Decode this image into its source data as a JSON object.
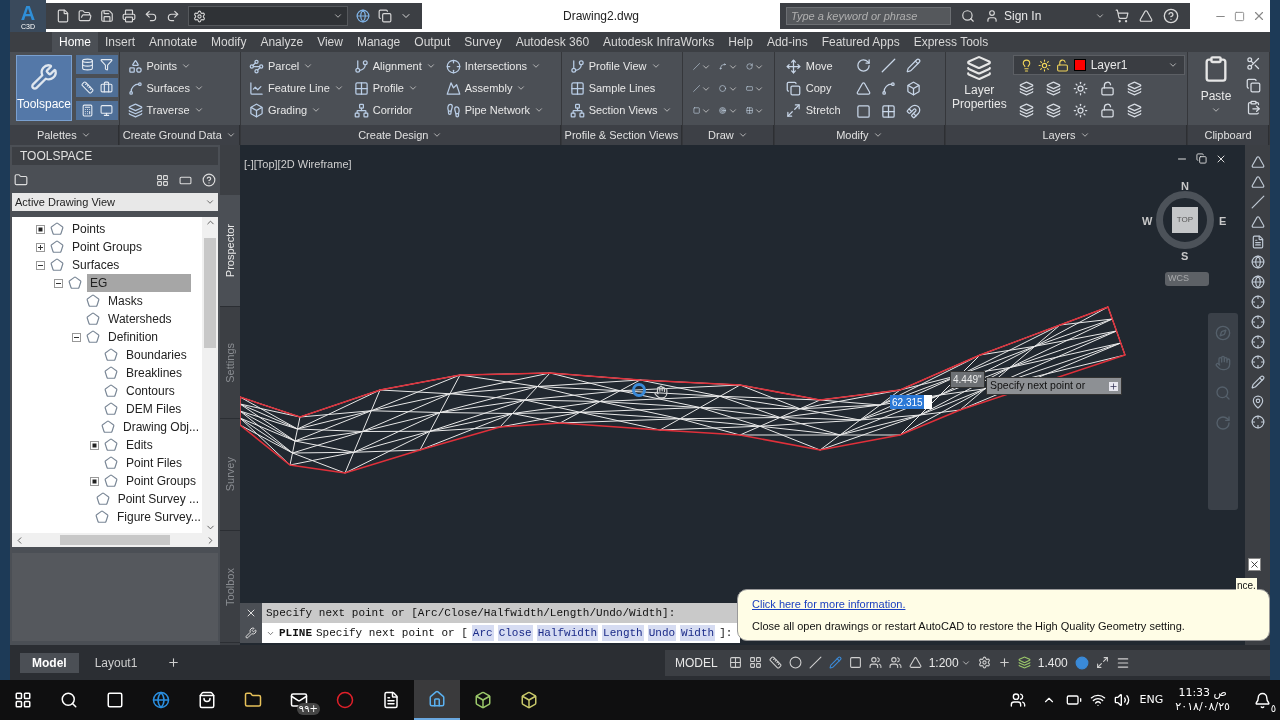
{
  "title_bar": {
    "logo_letter": "A",
    "logo_caption": "C3D",
    "document_title": "Drawing2.dwg",
    "search": {
      "placeholder": "Type a keyword or phrase"
    },
    "sign_in": "Sign In"
  },
  "ribbon_tabs": [
    {
      "label": "Home",
      "selected": true
    },
    {
      "label": "Insert",
      "selected": false
    },
    {
      "label": "Annotate",
      "selected": false
    },
    {
      "label": "Modify",
      "selected": false
    },
    {
      "label": "Analyze",
      "selected": false
    },
    {
      "label": "View",
      "selected": false
    },
    {
      "label": "Manage",
      "selected": false
    },
    {
      "label": "Output",
      "selected": false
    },
    {
      "label": "Survey",
      "selected": false
    },
    {
      "label": "Autodesk 360",
      "selected": false
    },
    {
      "label": "Autodesk InfraWorks",
      "selected": false
    },
    {
      "label": "Help",
      "selected": false
    },
    {
      "label": "Add-ins",
      "selected": false
    },
    {
      "label": "Featured Apps",
      "selected": false
    },
    {
      "label": "Express Tools",
      "selected": false
    }
  ],
  "ribbon_panels": [
    {
      "kind": "palettes",
      "title": "Palettes",
      "menu": true,
      "large": {
        "label": "Toolspace",
        "selected": true
      }
    },
    {
      "kind": "list",
      "title": "Create Ground Data",
      "menu": true,
      "columns": [
        [
          {
            "label": "Points",
            "dropdown": true
          },
          {
            "label": "Surfaces",
            "dropdown": true
          },
          {
            "label": "Traverse",
            "dropdown": true
          }
        ]
      ]
    },
    {
      "kind": "list",
      "title": "Create Design",
      "menu": true,
      "columns": [
        [
          {
            "label": "Parcel",
            "dropdown": true
          },
          {
            "label": "Feature Line",
            "dropdown": true
          },
          {
            "label": "Grading",
            "dropdown": true
          }
        ],
        [
          {
            "label": "Alignment",
            "dropdown": true
          },
          {
            "label": "Profile",
            "dropdown": true
          },
          {
            "label": "Corridor",
            "dropdown": false
          }
        ],
        [
          {
            "label": "Intersections",
            "dropdown": true
          },
          {
            "label": "Assembly",
            "dropdown": true
          },
          {
            "label": "Pipe Network",
            "dropdown": true
          }
        ]
      ]
    },
    {
      "kind": "list",
      "title": "Profile & Section Views",
      "menu": false,
      "columns": [
        [
          {
            "label": "Profile View",
            "dropdown": true
          },
          {
            "label": "Sample Lines",
            "dropdown": false
          },
          {
            "label": "Section Views",
            "dropdown": true
          }
        ]
      ]
    },
    {
      "kind": "draw",
      "title": "Draw",
      "menu": true
    },
    {
      "kind": "modify",
      "title": "Modify",
      "menu": true,
      "columns": [
        [
          {
            "label": "Move",
            "dropdown": false
          },
          {
            "label": "Copy",
            "dropdown": false
          },
          {
            "label": "Stretch",
            "dropdown": false
          }
        ]
      ]
    },
    {
      "kind": "layers",
      "title": "Layers",
      "menu": true,
      "large": {
        "label": "Layer Properties",
        "selected": false
      },
      "layer": {
        "name": "Layer1",
        "color": "#ff0000"
      }
    },
    {
      "kind": "clipboard",
      "title": "Clipboard",
      "menu": false,
      "large": {
        "label": "Paste",
        "selected": false
      }
    }
  ],
  "toolspace": {
    "title": "TOOLSPACE",
    "view": "Active Drawing View",
    "tree": [
      {
        "label": "Points",
        "kind": "dot",
        "selected": false
      },
      {
        "label": "Point Groups",
        "kind": "plus",
        "selected": false
      },
      {
        "label": "Surfaces",
        "kind": "minus",
        "selected": false,
        "children": [
          {
            "label": "EG",
            "kind": "minus",
            "selected": true,
            "children": [
              {
                "label": "Masks",
                "kind": "leaf",
                "selected": false
              },
              {
                "label": "Watersheds",
                "kind": "leaf",
                "selected": false
              },
              {
                "label": "Definition",
                "kind": "minus",
                "selected": false,
                "children": [
                  {
                    "label": "Boundaries",
                    "kind": "leaf",
                    "selected": false
                  },
                  {
                    "label": "Breaklines",
                    "kind": "leaf",
                    "selected": false
                  },
                  {
                    "label": "Contours",
                    "kind": "leaf",
                    "selected": false
                  },
                  {
                    "label": "DEM Files",
                    "kind": "leaf",
                    "selected": false
                  },
                  {
                    "label": "Drawing Obj...",
                    "kind": "leaf",
                    "selected": false
                  },
                  {
                    "label": "Edits",
                    "kind": "dot",
                    "selected": false
                  },
                  {
                    "label": "Point Files",
                    "kind": "leaf",
                    "selected": false
                  },
                  {
                    "label": "Point Groups",
                    "kind": "dot",
                    "selected": false
                  },
                  {
                    "label": "Point Survey ...",
                    "kind": "leaf",
                    "selected": false
                  },
                  {
                    "label": "Figure Survey...",
                    "kind": "leaf",
                    "selected": false
                  }
                ]
              }
            ]
          }
        ]
      }
    ],
    "side_tabs": [
      {
        "label": "Prospector",
        "selected": true
      },
      {
        "label": "Settings",
        "selected": false
      },
      {
        "label": "Survey",
        "selected": false
      },
      {
        "label": "Toolbox",
        "selected": false
      }
    ]
  },
  "viewport": {
    "label": "[-][Top][2D Wireframe]",
    "viewcube": {
      "face": "TOP",
      "north": "N",
      "south": "S",
      "east": "E",
      "west": "W",
      "ucs": "WCS"
    },
    "tooltip": {
      "dimension": "4.449\"",
      "input": "62.315",
      "prompt": "Specify next point or"
    }
  },
  "command_line": {
    "history": "Specify next point or [Arc/Close/Halfwidth/Length/Undo/Width]:",
    "command": "PLINE",
    "prompt": "Specify next point or [",
    "options": [
      "Arc",
      "Close",
      "Halfwidth",
      "Length",
      "Undo",
      "Width"
    ],
    "suffix": "]:"
  },
  "notification": {
    "link": "Click here for more information.",
    "message": "Close all open drawings or restart AutoCAD to restore the High Quality Geometry setting.",
    "stacked_text": "nce."
  },
  "layout_tabs": [
    {
      "label": "Model",
      "selected": true
    },
    {
      "label": "Layout1",
      "selected": false
    }
  ],
  "status_bar": {
    "space": "MODEL",
    "scale": "1:200",
    "value": "1.400"
  },
  "taskbar": {
    "mail_badge": "٩٩+",
    "language": "ENG",
    "time": "11:33 ص",
    "date": "٢٠١٨/٠٨/٢٥",
    "notification_count": "٥"
  }
}
